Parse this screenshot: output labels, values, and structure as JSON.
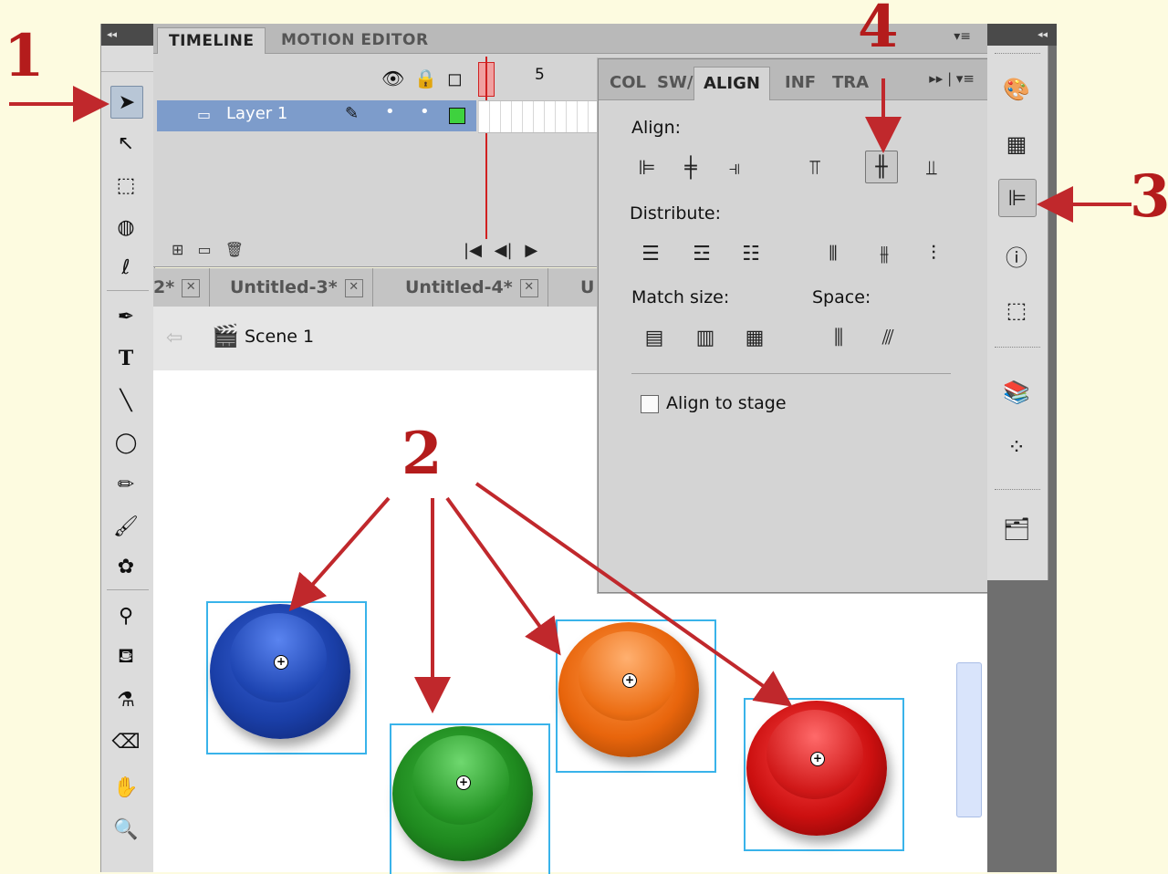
{
  "timeline": {
    "tabs": [
      "TIMELINE",
      "MOTION EDITOR"
    ],
    "frame_label": "5",
    "layer_name": "Layer 1"
  },
  "documents": {
    "tabs": [
      "2*",
      "Untitled-3*",
      "Untitled-4*",
      "U"
    ]
  },
  "scene": {
    "label": "Scene 1"
  },
  "align_panel": {
    "tabs": [
      "COL",
      "SW/",
      "ALIGN",
      "INF",
      "TRA"
    ],
    "active_tab": "ALIGN",
    "align_heading": "Align:",
    "distribute_heading": "Distribute:",
    "match_size_heading": "Match size:",
    "space_heading": "Space:",
    "align_to_stage_label": "Align to stage",
    "align_to_stage_checked": false
  },
  "toolbar": {
    "selected_tool": "selection-tool",
    "tools": [
      "selection-tool",
      "subselection-tool",
      "free-transform-tool",
      "3d-rotation-tool",
      "lasso-tool",
      "pen-tool",
      "text-tool",
      "line-tool",
      "oval-tool",
      "pencil-tool",
      "brush-tool",
      "deco-tool",
      "bone-tool",
      "paint-bucket-tool",
      "eyedropper-tool",
      "eraser-tool",
      "hand-tool",
      "zoom-tool"
    ]
  },
  "dock": {
    "selected_panel": "align-panel-icon",
    "icons": [
      "color-palette-icon",
      "swatches-icon",
      "align-panel-icon",
      "info-icon",
      "transform-icon",
      "library-icon",
      "motion-presets-icon",
      "components-icon"
    ]
  },
  "stage_buttons": [
    {
      "name": "blue-button",
      "color": "#1a3fa8"
    },
    {
      "name": "green-button",
      "color": "#1f8a1f"
    },
    {
      "name": "orange-button",
      "color": "#e8650c"
    },
    {
      "name": "red-button",
      "color": "#cc1010"
    }
  ],
  "annotations": {
    "marker_1": "1",
    "marker_2": "2",
    "marker_3": "3",
    "marker_4": "4",
    "color": "#b41c1c"
  }
}
